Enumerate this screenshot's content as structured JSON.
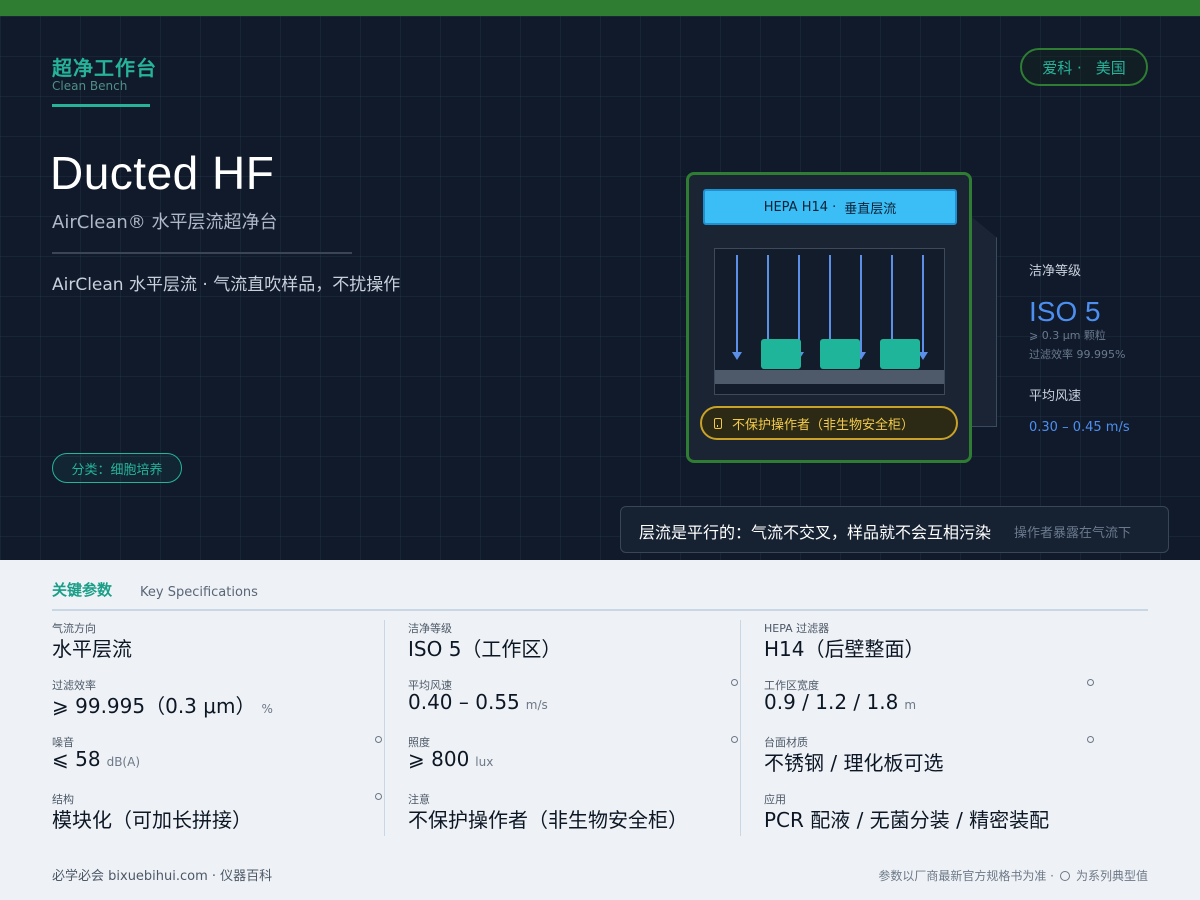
{
  "header": {
    "category_zh": "超净工作台",
    "category_en": "Clean Bench",
    "brand": [
      "爱科 ·",
      "美国"
    ]
  },
  "hero": {
    "title": "Ducted HF",
    "subtitle": "AirClean® 水平层流超净台",
    "tagline": "AirClean 水平层流 ·  气流直吹样品，不扰操作",
    "tag": "分类：细胞培养"
  },
  "device": {
    "filter_label": [
      "HEPA H14 ·",
      "垂直层流"
    ],
    "warning": "不保护操作者（非生物安全柜）"
  },
  "side_panel": {
    "class_label": "洁净等级",
    "class_value": "ISO 5",
    "particle_note": "⩾ 0.3 μm 颗粒",
    "efficiency_note": "过滤效率 99.995%",
    "speed_label": "平均风速",
    "speed_value": "0.30 – 0.45 m/s"
  },
  "note": {
    "main": "层流是平行的：气流不交叉，样品就不会互相污染",
    "sub": "操作者暴露在气流下"
  },
  "specs": {
    "title": "关键参数",
    "title_en": "Key Specifications",
    "cells": [
      {
        "label": "气流方向",
        "value": "水平层流",
        "unit": ""
      },
      {
        "label": "洁净等级",
        "value": "ISO 5（工作区）",
        "unit": ""
      },
      {
        "label": "HEPA 过滤器",
        "value": "H14（后壁整面）",
        "unit": ""
      },
      {
        "label": "过滤效率",
        "value": "⩾ 99.995（0.3 μm）",
        "unit": "%"
      },
      {
        "label": "平均风速",
        "value": "0.40 – 0.55",
        "unit": "m/s"
      },
      {
        "label": "工作区宽度",
        "value": "0.9 / 1.2 / 1.8",
        "unit": "m"
      },
      {
        "label": "噪音",
        "value": "⩽ 58",
        "unit": "dB(A)"
      },
      {
        "label": "照度",
        "value": "⩾ 800",
        "unit": "lux"
      },
      {
        "label": "台面材质",
        "value": "不锈钢 / 理化板可选",
        "unit": ""
      },
      {
        "label": "结构",
        "value": "模块化（可加长拼接）",
        "unit": ""
      },
      {
        "label": "注意",
        "value": "不保护操作者（非生物安全柜）",
        "unit": ""
      },
      {
        "label": "应用",
        "value": "PCR 配液 / 无菌分装 / 精密装配",
        "unit": ""
      }
    ]
  },
  "footer": {
    "source": "必学必会 bixuebihui.com ·   仪器百科",
    "disclaimer": "参数以厂商最新官方规格书为准 ·",
    "typical": "为系列典型值"
  }
}
